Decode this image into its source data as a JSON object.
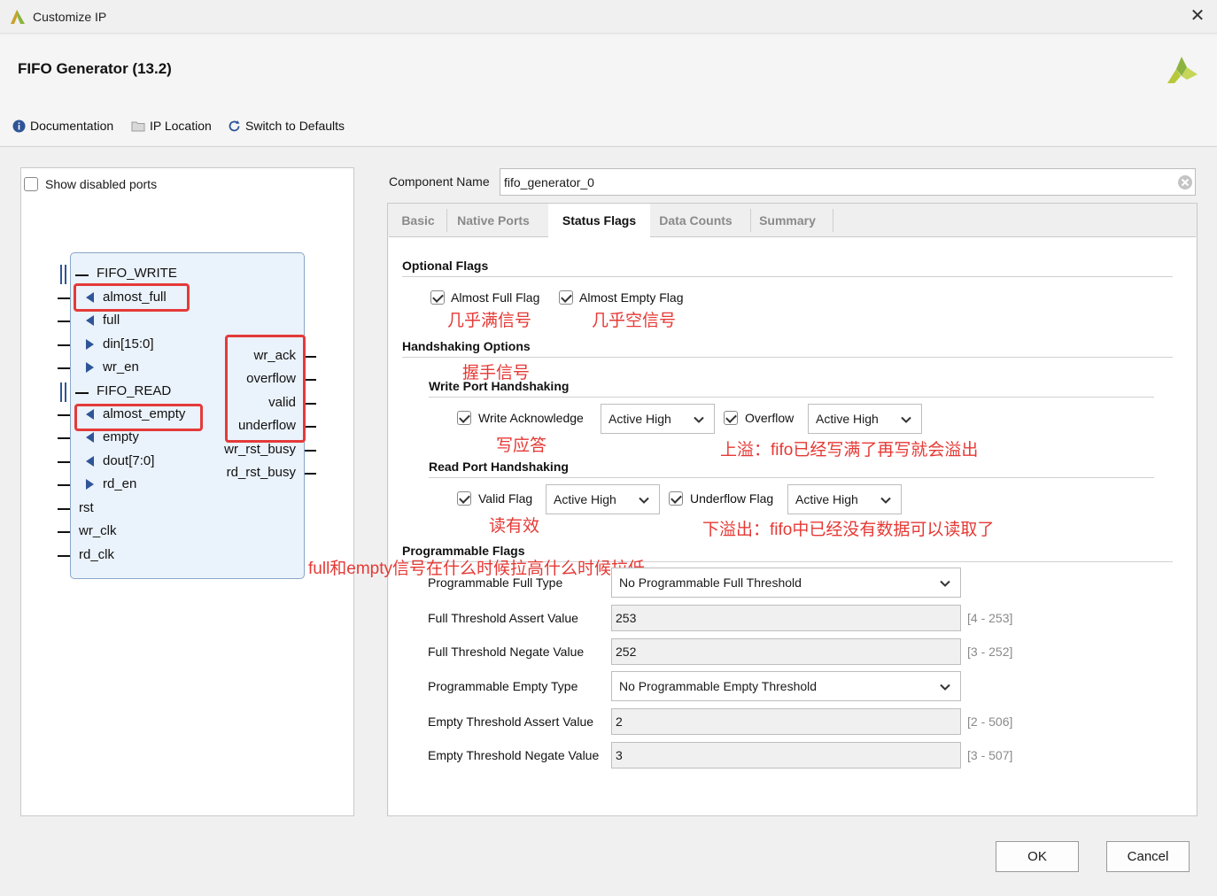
{
  "window": {
    "title": "Customize IP",
    "close": "✕"
  },
  "header": {
    "ip_title": "FIFO Generator (13.2)"
  },
  "toolbar": {
    "documentation": "Documentation",
    "ip_location": "IP Location",
    "switch_defaults": "Switch to Defaults"
  },
  "left": {
    "show_disabled_ports": "Show disabled ports",
    "ports": {
      "fifo_write": "FIFO_WRITE",
      "almost_full": "almost_full",
      "full": "full",
      "din": "din[15:0]",
      "wr_en": "wr_en",
      "fifo_read": "FIFO_READ",
      "almost_empty": "almost_empty",
      "empty": "empty",
      "dout": "dout[7:0]",
      "rd_en": "rd_en",
      "rst": "rst",
      "wr_clk": "wr_clk",
      "rd_clk": "rd_clk",
      "wr_ack": "wr_ack",
      "overflow": "overflow",
      "valid": "valid",
      "underflow": "underflow",
      "wr_rst_busy": "wr_rst_busy",
      "rd_rst_busy": "rd_rst_busy"
    }
  },
  "component": {
    "label": "Component Name",
    "value": "fifo_generator_0"
  },
  "tabs": [
    "Basic",
    "Native Ports",
    "Status Flags",
    "Data Counts",
    "Summary"
  ],
  "status_flags": {
    "optional_flags": "Optional Flags",
    "almost_full_flag": "Almost Full Flag",
    "almost_empty_flag": "Almost Empty Flag",
    "handshaking_options": "Handshaking Options",
    "write_port_handshaking": "Write Port Handshaking",
    "write_ack": "Write Acknowledge",
    "write_ack_value": "Active High",
    "overflow": "Overflow",
    "overflow_value": "Active High",
    "read_port_handshaking": "Read Port Handshaking",
    "valid_flag": "Valid Flag",
    "valid_value": "Active High",
    "underflow_flag": "Underflow Flag",
    "underflow_value": "Active High",
    "programmable_flags": "Programmable Flags",
    "prog_full_type_label": "Programmable Full Type",
    "prog_full_type_value": "No Programmable Full Threshold",
    "full_assert_label": "Full Threshold Assert Value",
    "full_assert_value": "253",
    "full_assert_range": "[4 - 253]",
    "full_negate_label": "Full Threshold Negate Value",
    "full_negate_value": "252",
    "full_negate_range": "[3 - 252]",
    "prog_empty_type_label": "Programmable Empty Type",
    "prog_empty_type_value": "No Programmable Empty Threshold",
    "empty_assert_label": "Empty Threshold Assert Value",
    "empty_assert_value": "2",
    "empty_assert_range": "[2 - 506]",
    "empty_negate_label": "Empty Threshold Negate Value",
    "empty_negate_value": "3",
    "empty_negate_range": "[3 - 507]"
  },
  "annotations": {
    "almost_full": "几乎满信号",
    "almost_empty": "几乎空信号",
    "handshake": "握手信号",
    "write_ack": "写应答",
    "overflow": "上溢：fifo已经写满了再写就会溢出",
    "valid": "读有效",
    "underflow": "下溢出：fifo中已经没有数据可以读取了",
    "full_empty": "full和empty信号在什么时候拉高什么时候拉低"
  },
  "buttons": {
    "ok": "OK",
    "cancel": "Cancel"
  },
  "colors": {
    "annotation": "#e53935",
    "xilinx_green": "#8cb33f",
    "block_fill": "#eaf2fb"
  }
}
